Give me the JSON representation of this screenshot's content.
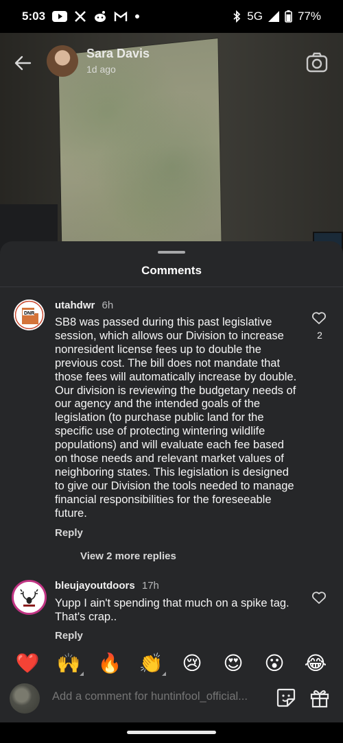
{
  "status_bar": {
    "time": "5:03",
    "network": "5G",
    "battery": "77%"
  },
  "story": {
    "username": "Sara Davis",
    "posted": "1d ago"
  },
  "comments_sheet": {
    "title": "Comments",
    "comments": [
      {
        "username": "utahdwr",
        "time": "6h",
        "text": "SB8 was passed during this past legislative session, which allows our Division to increase nonresident license fees up to double the previous cost. The bill does not mandate that those fees will automatically increase by double. Our division is reviewing the budgetary needs of our agency and the intended goals of the legislation (to purchase public land for the specific use of protecting wintering wildlife populations) and will evaluate each fee based on those needs and relevant market values of neighboring states. This legislation is designed to give our Division the tools needed to manage financial responsibilities for the foreseeable future.",
        "reply_label": "Reply",
        "likes": "2",
        "view_replies": "View 2 more replies",
        "avatar_label": "DNR"
      },
      {
        "username": "bleujayoutdoors",
        "time": "17h",
        "text": "Yupp I ain't spending that much on a spike tag. That's crap..",
        "reply_label": "Reply"
      }
    ],
    "quick_reactions": [
      "❤️",
      "🙌",
      "🔥",
      "👏",
      "😢",
      "😍",
      "😮",
      "😂"
    ],
    "composer": {
      "placeholder": "Add a comment for huntinfool_official..."
    }
  },
  "colors": {
    "sheet_bg": "#262729",
    "story_ring": "#c13584"
  }
}
